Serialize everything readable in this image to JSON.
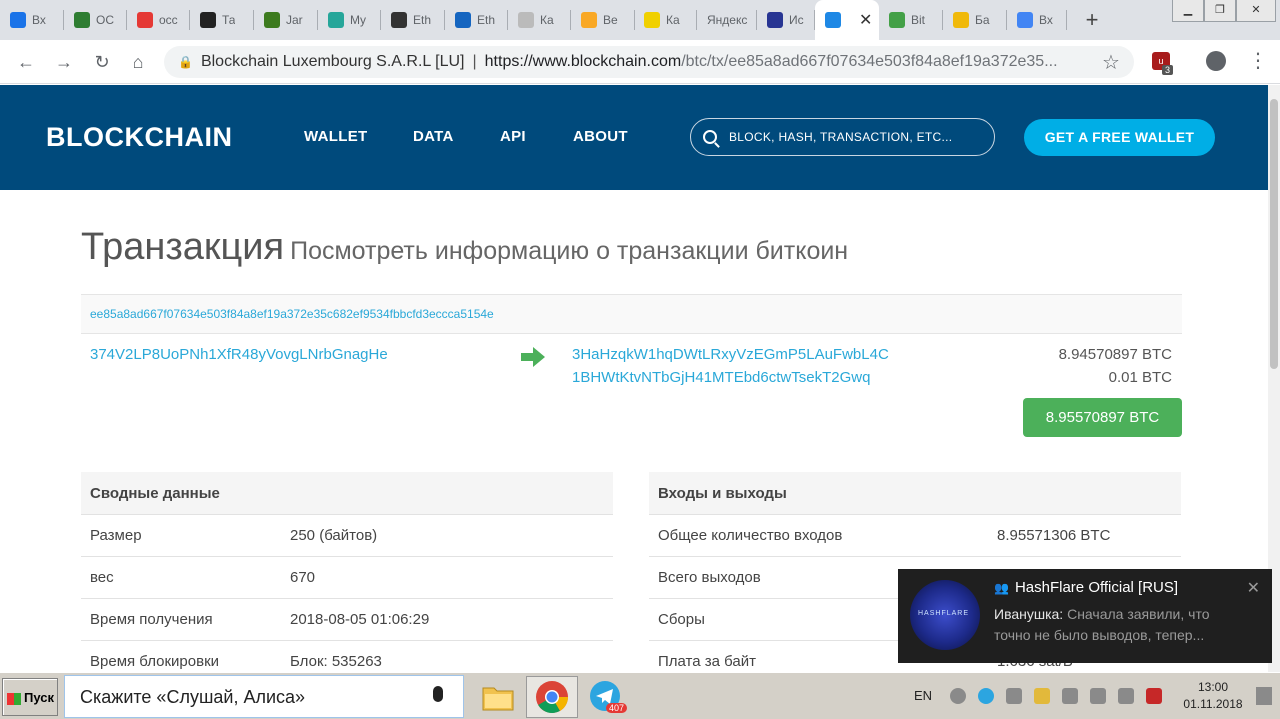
{
  "browser": {
    "tabs": [
      {
        "label": "Вх",
        "icon": "mail-icon",
        "color": "#1a73e8"
      },
      {
        "label": "ОС",
        "icon": "grid-icon",
        "color": "#2e7d32"
      },
      {
        "label": "осс",
        "icon": "yandex-icon",
        "color": "#e53935"
      },
      {
        "label": "Та",
        "icon": "tab-icon",
        "color": "#222222"
      },
      {
        "label": "Jar",
        "icon": "jar-icon",
        "color": "#3d7b1f"
      },
      {
        "label": "My",
        "icon": "my-icon",
        "color": "#26a69a"
      },
      {
        "label": "Eth",
        "icon": "ethereum-icon",
        "color": "#333333"
      },
      {
        "label": "Eth",
        "icon": "chart-icon",
        "color": "#1565c0"
      },
      {
        "label": "Ка",
        "icon": "ka-icon",
        "color": "#bbbbbb"
      },
      {
        "label": "Ве",
        "icon": "bee-icon",
        "color": "#f9a825"
      },
      {
        "label": "Ка",
        "icon": "diamond-icon",
        "color": "#f0d000"
      },
      {
        "label": "Яндекс",
        "icon": "",
        "color": ""
      },
      {
        "label": "Ис",
        "icon": "h-icon",
        "color": "#283593"
      },
      {
        "label": "",
        "icon": "blockchain-icon",
        "color": "#1e88e5",
        "active": true
      },
      {
        "label": "Bit",
        "icon": "leaf-icon",
        "color": "#43a047"
      },
      {
        "label": "Ба",
        "icon": "binance-icon",
        "color": "#f0b90b"
      },
      {
        "label": "Вх",
        "icon": "google-icon",
        "color": "#4285f4"
      }
    ],
    "url_org": "Blockchain Luxembourg S.A.R.L [LU]",
    "url_host": "https://www.blockchain.com",
    "url_path": "/btc/tx/ee85a8ad667f07634e503f84a8ef19a372e35...",
    "extension_badge": "3"
  },
  "site": {
    "logo": "BLOCKCHAIN",
    "nav": [
      "WALLET",
      "DATA",
      "API",
      "ABOUT"
    ],
    "search_placeholder": "BLOCK, HASH, TRANSACTION, ETC...",
    "cta": "GET A FREE WALLET"
  },
  "page": {
    "title": "Транзакция",
    "subtitle": "Посмотреть информацию о транзакции биткоин",
    "tx_hash": "ee85a8ad667f07634e503f84a8ef19a372e35c682ef9534fbbcfd3eccca5154e",
    "from_address": "374V2LP8UoPNh1XfR48yVovgLNrbGnagHe",
    "outputs": [
      {
        "address": "3HaHzqkW1hqDWtLRxyVzEGmP5LAuFwbL4C",
        "amount": "8.94570897 BTC"
      },
      {
        "address": "1BHWtKtvNTbGjH41MTEbd6ctwTsekT2Gwq",
        "amount": "0.01 BTC"
      }
    ],
    "total": "8.95570897 BTC",
    "summary": {
      "header": "Сводные данные",
      "rows": [
        {
          "key": "Размер",
          "value": "250 (байтов)"
        },
        {
          "key": "вес",
          "value": "670"
        },
        {
          "key": "Время получения",
          "value": "2018-08-05 01:06:29"
        },
        {
          "key": "Время блокировки",
          "value": "Блок: 535263"
        }
      ]
    },
    "io": {
      "header": "Входы и выходы",
      "rows": [
        {
          "key": "Общее количество входов",
          "value": "8.95571306 BTC"
        },
        {
          "key": "Всего выходов",
          "value": ""
        },
        {
          "key": "Сборы",
          "value": ""
        },
        {
          "key": "Плата за байт",
          "value": "1.636 sat/B"
        }
      ]
    }
  },
  "notification": {
    "title": "HashFlare Official [RUS]",
    "sender": "Иванушка:",
    "line1": "Сначала заявили, что",
    "line2": "точно не было выводов, тепер...",
    "avatar_text": "HASHFLARE"
  },
  "taskbar": {
    "start": "Пуск",
    "alice": "Скажите «Слушай, Алиса»",
    "telegram_badge": "407",
    "lang": "EN",
    "time": "13:00",
    "date": "01.11.2018"
  }
}
